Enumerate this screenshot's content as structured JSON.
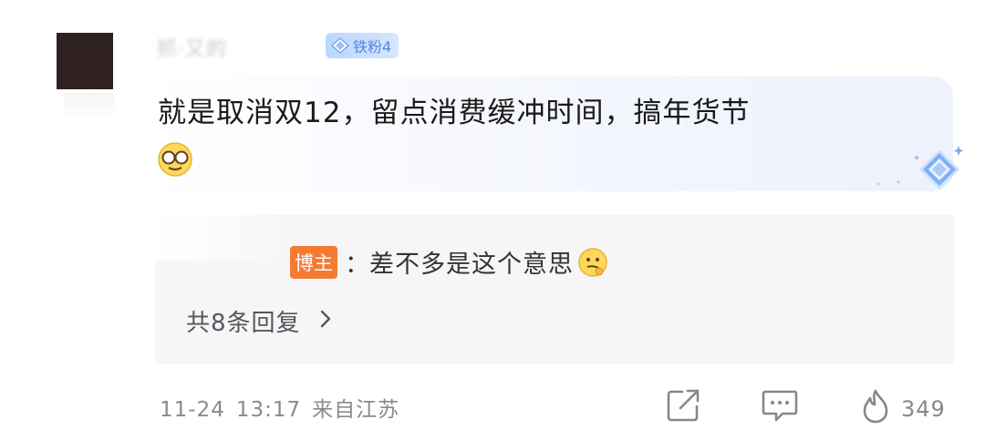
{
  "comment": {
    "username": "抓·又的",
    "fan_badge": "铁粉4",
    "text": "就是取消双12，留点消费缓冲时间，搞年货节",
    "emoji_name": "glasses-smile-emoji"
  },
  "reply": {
    "author_tag": "博主",
    "separator": "：",
    "text": "差不多是这个意思",
    "emoji_name": "thinking-emoji",
    "count_label": "共8条回复"
  },
  "meta": {
    "date": "11-24",
    "time": "13:17",
    "location": "来自江苏"
  },
  "actions": {
    "share_icon": "share-icon",
    "comment_icon": "comment-icon",
    "like_icon": "fire-icon",
    "like_count": "349"
  },
  "colors": {
    "author_tag": "#f57b33",
    "fan_badge": "#5a86d8",
    "meta_text": "#8a8a8a"
  }
}
